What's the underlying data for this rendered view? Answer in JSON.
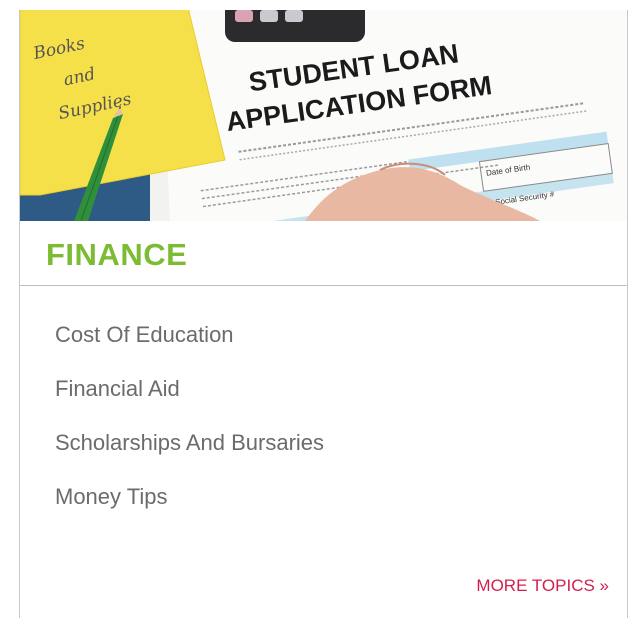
{
  "hero": {
    "note_text": [
      "Books",
      "and",
      "Supplies"
    ],
    "form_title_line1": "STUDENT LOAN",
    "form_title_line2": "APPLICATION FORM",
    "form_cell_1": "Date of Birth",
    "form_cell_2": "Social Security #"
  },
  "section": {
    "title": "FINANCE"
  },
  "topics": [
    "Cost Of Education",
    "Financial Aid",
    "Scholarships And Bursaries",
    "Money Tips"
  ],
  "more_link": {
    "label": "MORE TOPICS »"
  },
  "colors": {
    "accent_green": "#7cbb34",
    "link_red": "#d31f4d",
    "topic_gray": "#6b6b6b",
    "note_yellow": "#f6e04a"
  }
}
